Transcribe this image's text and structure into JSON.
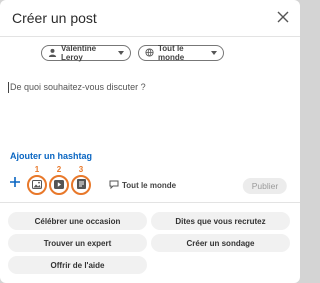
{
  "modal": {
    "title": "Créer un post",
    "close_icon": "close-icon"
  },
  "audience": {
    "user_name": "Valentine Leroy",
    "user_icon": "person-icon",
    "visibility": "Tout le monde",
    "visibility_icon": "globe-icon"
  },
  "compose": {
    "placeholder": "De quoi souhaitez-vous discuter ?"
  },
  "hashtag": {
    "label": "Ajouter un hashtag"
  },
  "toolbar": {
    "add_icon": "plus-icon",
    "markers": [
      {
        "number": "1",
        "icon": "image-icon"
      },
      {
        "number": "2",
        "icon": "video-icon"
      },
      {
        "number": "3",
        "icon": "document-icon"
      }
    ],
    "comment_visibility": "Tout le monde",
    "comment_icon": "comment-icon",
    "publish_label": "Publier"
  },
  "suggestions": [
    "Célébrer une occasion",
    "Dites que vous recrutez",
    "Trouver un expert",
    "Créer un sondage",
    "Offrir de l'aide"
  ],
  "colors": {
    "accent_link": "#0a66c2",
    "annotation": "#e8782a",
    "publish_disabled_bg": "#ececec",
    "publish_disabled_text": "#9a9a9a",
    "chip_bg": "#f1f1f1"
  }
}
